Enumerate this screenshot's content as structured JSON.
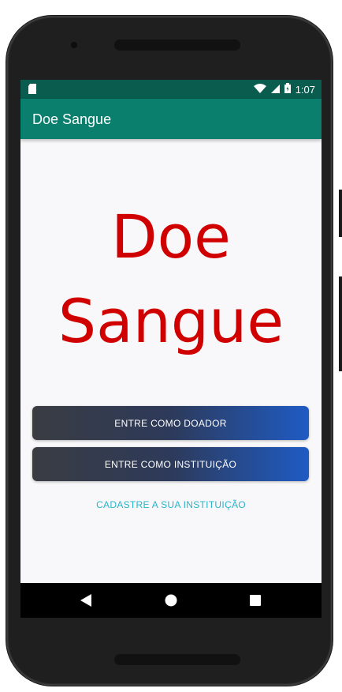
{
  "status_bar": {
    "time": "1:07",
    "icons": [
      "sd-card-icon",
      "wifi-icon",
      "cell-signal-icon",
      "battery-icon"
    ]
  },
  "app_bar": {
    "title": "Doe Sangue"
  },
  "hero": {
    "line1": "Doe",
    "line2": "Sangue",
    "color": "#d10000"
  },
  "buttons": {
    "donor_label": "ENTRE COMO DOADOR",
    "institution_label": "ENTRE COMO INSTITUIÇÃO"
  },
  "link": {
    "register_label": "CADASTRE A SUA INSTITUIÇÃO",
    "color": "#26b5c9"
  },
  "nav_bar": {
    "icons": [
      "back-icon",
      "home-icon",
      "recents-icon"
    ]
  },
  "colors": {
    "status_bar": "#0a5c4e",
    "app_bar": "#0b7f6e",
    "background": "#f8f8fa"
  }
}
